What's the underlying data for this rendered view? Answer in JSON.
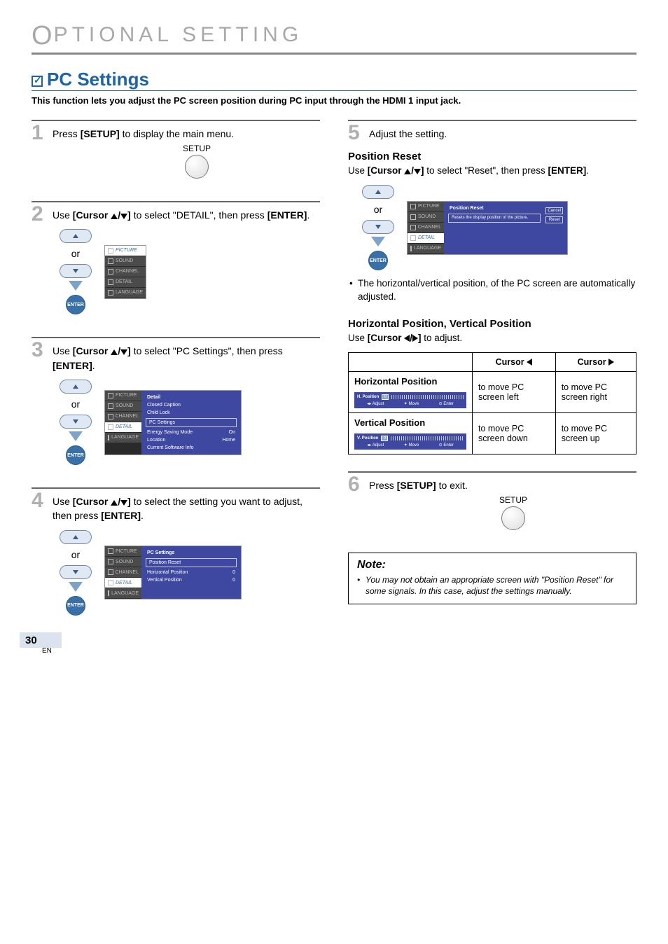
{
  "chapter": "PTIONAL  SETTING",
  "section_title": "PC Settings",
  "section_desc": "This function lets you adjust the PC screen position during PC input through the HDMI 1 input jack.",
  "steps": {
    "s1": {
      "num": "1",
      "text_pre": "Press ",
      "text_b1": "[SETUP]",
      "text_post": " to display the main menu.",
      "btn_label": "SETUP"
    },
    "s2": {
      "num": "2",
      "text_pre": "Use ",
      "text_b1": "[Cursor ",
      "text_mid": "]",
      "text_post": " to select \"DETAIL\", then press ",
      "text_b2": "[ENTER]",
      "dot": "."
    },
    "s3": {
      "num": "3",
      "text_pre": "Use ",
      "text_b1": "[Cursor ",
      "text_mid": "]",
      "text_post": " to select \"PC Settings\", then press ",
      "text_b2": "[ENTER]",
      "dot": "."
    },
    "s4": {
      "num": "4",
      "text_pre": "Use ",
      "text_b1": "[Cursor ",
      "text_mid": "]",
      "text_post": " to select the setting you want to adjust, then press ",
      "text_b2": "[ENTER]",
      "dot": "."
    },
    "s5": {
      "num": "5",
      "text": "Adjust the setting."
    },
    "s6": {
      "num": "6",
      "text_pre": "Press ",
      "text_b1": "[SETUP]",
      "text_post": " to exit.",
      "btn_label": "SETUP"
    }
  },
  "or_label": "or",
  "enter_label": "ENTER",
  "osd_side": {
    "picture": "PICTURE",
    "sound": "SOUND",
    "channel": "CHANNEL",
    "detail": "DETAIL",
    "language": "LANGUAGE"
  },
  "osd2": {
    "selected": "PICTURE"
  },
  "osd3": {
    "title": "Detail",
    "rows": {
      "cc": "Closed Caption",
      "cl": "Child Lock",
      "pcs": "PC Settings",
      "esm": "Energy Saving Mode",
      "esm_val": "On",
      "loc": "Location",
      "loc_val": "Home",
      "csi": "Current Software Info"
    }
  },
  "osd4": {
    "title": "PC Settings",
    "rows": {
      "pr": "Position Reset",
      "hp": "Horizontal Position",
      "hp_val": "0",
      "vp": "Vertical Position",
      "vp_val": "0"
    }
  },
  "pos_reset": {
    "heading": "Position Reset",
    "text_pre": "Use ",
    "text_b1": "[Cursor ",
    "text_mid": "]",
    "text_post": " to select \"Reset\", then press ",
    "text_b2": "[ENTER]",
    "dot": ".",
    "osd_title": "Position Reset",
    "osd_desc": "Resets the display position of the picture.",
    "btn1": "Cancel",
    "btn2": "Reset",
    "bullet": "The horizontal/vertical position, of the PC screen are automatically adjusted."
  },
  "hv": {
    "heading": "Horizontal Position, Vertical Position",
    "text_pre": "Use ",
    "text_b1": "[Cursor ",
    "text_mid": "]",
    "text_post": " to adjust.",
    "col_left": "Cursor",
    "col_right": "Cursor",
    "row_h_label": "Horizontal Position",
    "row_v_label": "Vertical Position",
    "slider_h_label": "H. Position",
    "slider_v_label": "V. Position",
    "slider_zero": "0",
    "foot_adjust": "Adjust",
    "foot_move": "Move",
    "foot_enter": "Enter",
    "cell_h_left": "to move PC screen left",
    "cell_h_right": "to move PC screen right",
    "cell_v_left": "to move PC screen down",
    "cell_v_right": "to move PC screen up"
  },
  "note": {
    "title": "Note:",
    "text": "You may not obtain an appropriate screen with \"Position Reset\" for some signals. In this case, adjust the settings manually."
  },
  "page_number": "30",
  "page_lang": "EN"
}
